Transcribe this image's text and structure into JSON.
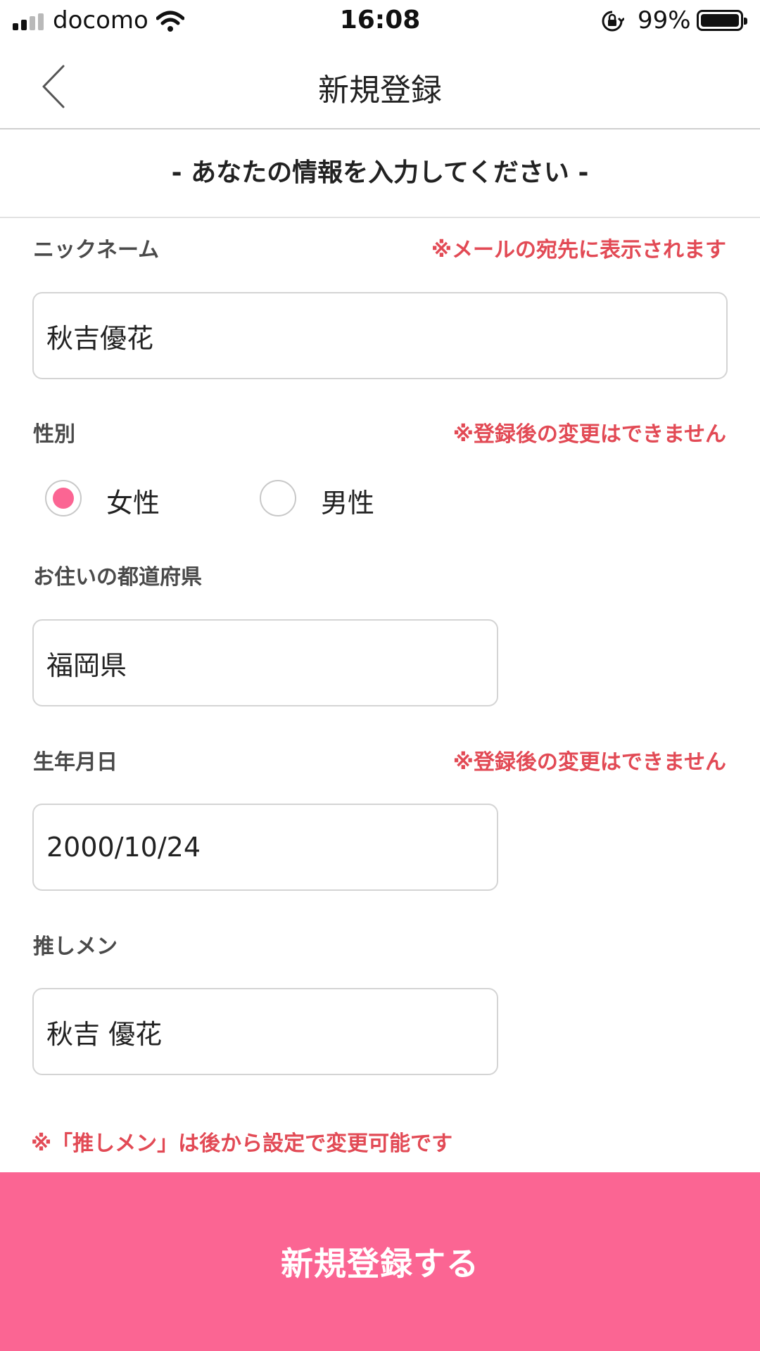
{
  "status_bar": {
    "carrier": "docomo",
    "time": "16:08",
    "battery": "99%"
  },
  "nav": {
    "title": "新規登録"
  },
  "banner": {
    "text": "- あなたの情報を入力してください -"
  },
  "form": {
    "nickname": {
      "label": "ニックネーム",
      "note": "※メールの宛先に表示されます",
      "value": "秋吉優花"
    },
    "gender": {
      "label": "性別",
      "note": "※登録後の変更はできません",
      "options": [
        {
          "label": "女性",
          "selected": true
        },
        {
          "label": "男性",
          "selected": false
        }
      ]
    },
    "prefecture": {
      "label": "お住いの都道府県",
      "value": "福岡県"
    },
    "birthday": {
      "label": "生年月日",
      "note": "※登録後の変更はできません",
      "value": "2000/10/24"
    },
    "favorite_member": {
      "label": "推しメン",
      "value": "秋吉 優花"
    },
    "footer_note": "※「推しメン」は後から設定で変更可能です"
  },
  "submit": {
    "label": "新規登録する"
  },
  "colors": {
    "accent": "#fb6593",
    "warning": "#e24a55"
  },
  "icons": {
    "back": "chevron-left-icon",
    "wifi": "wifi-icon",
    "rotation_lock": "rotation-lock-icon",
    "battery": "battery-icon",
    "signal": "signal-bars-icon"
  }
}
